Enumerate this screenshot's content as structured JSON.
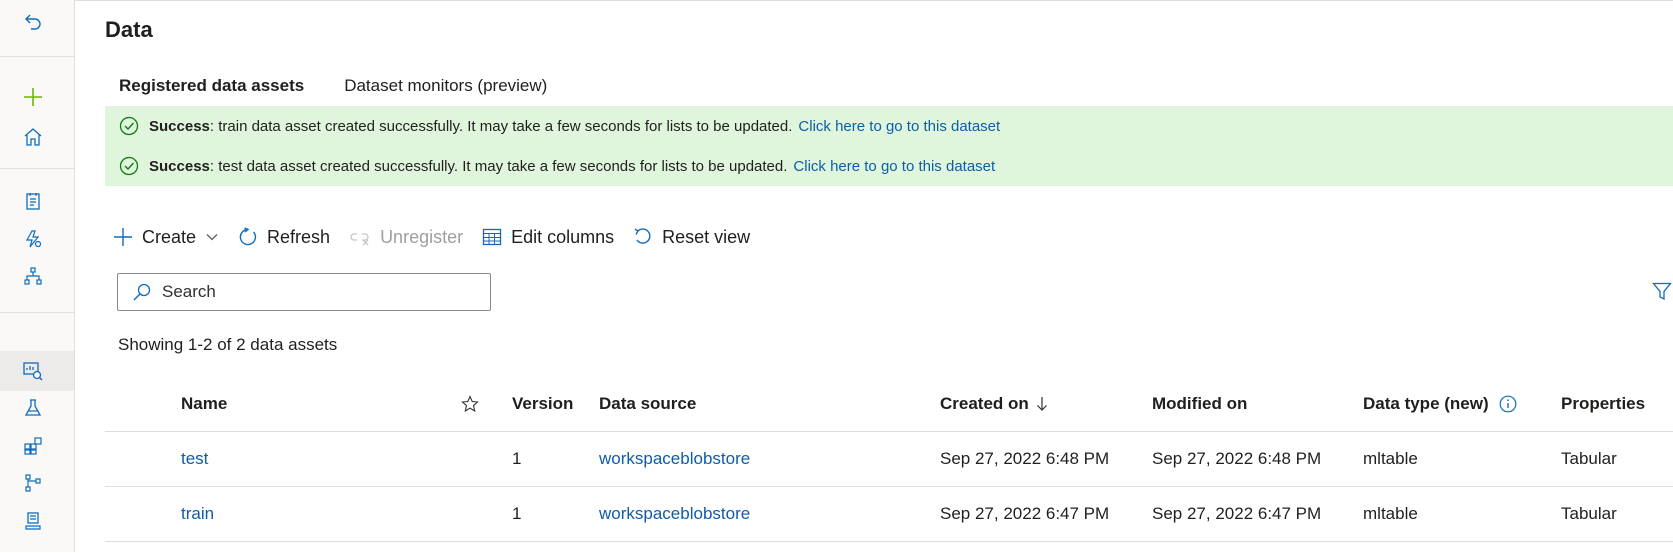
{
  "page": {
    "title": "Data"
  },
  "tabs": [
    {
      "label": "Registered data assets",
      "active": true
    },
    {
      "label": "Dataset monitors (preview)",
      "active": false
    }
  ],
  "banners": [
    {
      "bold": "Success",
      "text": ": train data asset created successfully. It may take a few seconds for lists to be updated.",
      "link": "Click here to go to this dataset"
    },
    {
      "bold": "Success",
      "text": ": test data asset created successfully. It may take a few seconds for lists to be updated.",
      "link": "Click here to go to this dataset"
    }
  ],
  "toolbar": {
    "create": "Create",
    "refresh": "Refresh",
    "unregister": "Unregister",
    "edit_columns": "Edit columns",
    "reset_view": "Reset view"
  },
  "search": {
    "placeholder": "Search",
    "value": ""
  },
  "showing": "Showing 1-2 of 2 data assets",
  "table": {
    "headers": {
      "name": "Name",
      "version": "Version",
      "source": "Data source",
      "created": "Created on",
      "modified": "Modified on",
      "type": "Data type (new)",
      "properties": "Properties"
    },
    "rows": [
      {
        "name": "test",
        "version": "1",
        "source": "workspaceblobstore",
        "created": "Sep 27, 2022 6:48 PM",
        "modified": "Sep 27, 2022 6:48 PM",
        "type": "mltable",
        "properties": "Tabular"
      },
      {
        "name": "train",
        "version": "1",
        "source": "workspaceblobstore",
        "created": "Sep 27, 2022 6:47 PM",
        "modified": "Sep 27, 2022 6:47 PM",
        "type": "mltable",
        "properties": "Tabular"
      }
    ]
  },
  "colors": {
    "accent": "#0f6cbd",
    "link": "#0f5ca8",
    "success_bg": "#dff6dd",
    "success_icon": "#107c10",
    "add_green": "#6bb700"
  },
  "rail_icons": [
    "back-arrow-icon",
    "plus-icon",
    "home-icon",
    "notebook-icon",
    "automl-icon",
    "designer-icon",
    "data-icon",
    "experiments-icon",
    "components-icon",
    "pipelines-icon",
    "models-icon"
  ]
}
